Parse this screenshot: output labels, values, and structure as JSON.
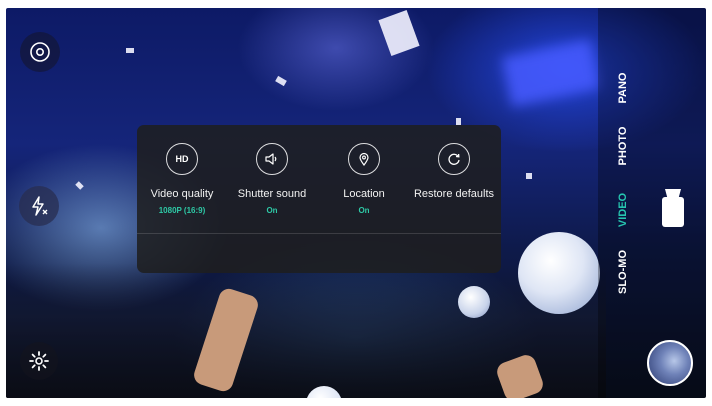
{
  "settings_panel": {
    "items": [
      {
        "icon_text": "HD",
        "icon": "hd-icon",
        "label": "Video quality",
        "value": "1080P (16:9)"
      },
      {
        "icon_text": "",
        "icon": "speaker-icon",
        "label": "Shutter sound",
        "value": "On"
      },
      {
        "icon_text": "",
        "icon": "location-pin-icon",
        "label": "Location",
        "value": "On"
      },
      {
        "icon_text": "",
        "icon": "refresh-icon",
        "label": "Restore defaults",
        "value": ""
      }
    ]
  },
  "modes": {
    "items": [
      "PANO",
      "PHOTO",
      "VIDEO",
      "SLO-MO"
    ],
    "active": "VIDEO"
  },
  "colors": {
    "accent": "#26c6b0",
    "panel_bg": "#1e1e1e"
  },
  "icons": {
    "top_left": "camera-switch-icon",
    "left_middle": "flash-auto-icon",
    "bottom_left": "settings-gear-icon",
    "shutter": "video-record-icon",
    "gallery": "gallery-thumbnail"
  }
}
